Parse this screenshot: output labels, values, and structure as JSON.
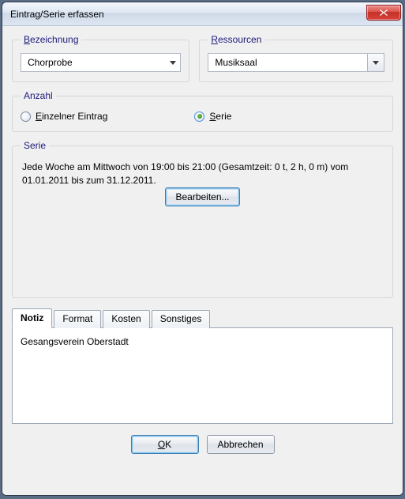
{
  "window": {
    "title": "Eintrag/Serie erfassen"
  },
  "bezeichnung": {
    "legend_pre": "B",
    "legend_post": "ezeichnung",
    "value": "Chorprobe"
  },
  "ressourcen": {
    "legend_pre": "R",
    "legend_post": "essourcen",
    "value": "Musiksaal"
  },
  "anzahl": {
    "legend": "Anzahl",
    "single_pre": "E",
    "single_post": "inzelner Eintrag",
    "serie_pre": "S",
    "serie_post": "erie"
  },
  "serie": {
    "legend": "Serie",
    "text": "Jede Woche am Mittwoch von 19:00 bis 21:00 (Gesamtzeit: 0 t, 2 h, 0 m) vom 01.01.2011 bis zum 31.12.2011.",
    "edit_label": "Bearbeiten..."
  },
  "tabs": {
    "notiz": "Notiz",
    "format": "Format",
    "kosten": "Kosten",
    "sonstiges": "Sonstiges"
  },
  "notiz": {
    "content": "Gesangsverein Oberstadt"
  },
  "buttons": {
    "ok_pre": "O",
    "ok_post": "K",
    "cancel": "Abbrechen"
  }
}
